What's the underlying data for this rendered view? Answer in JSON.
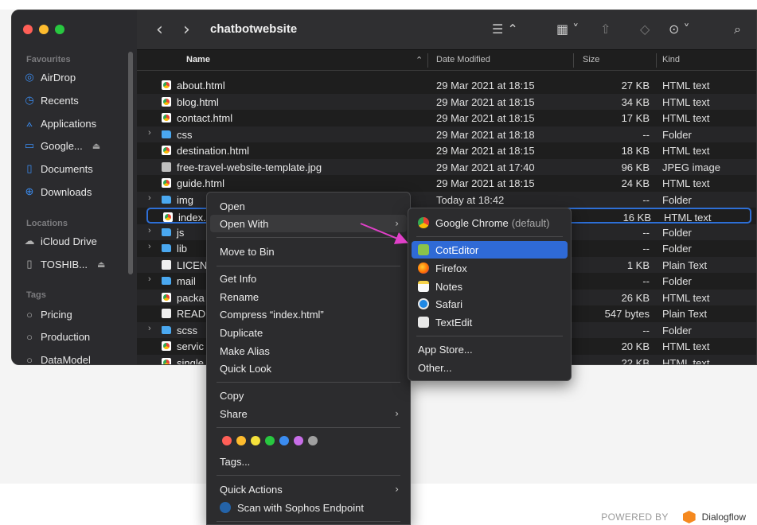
{
  "window": {
    "title": "chatbotwebsite",
    "traffic": [
      "close",
      "minimize",
      "maximize"
    ]
  },
  "toolbar": {
    "back_icon": "chevron-left-icon",
    "forward_icon": "chevron-right-icon",
    "view_icon": "list-view-icon",
    "group_icon": "group-icon",
    "share_icon": "share-icon",
    "tag_icon": "tag-icon",
    "more_icon": "ellipsis-circle-icon",
    "search_icon": "search-icon"
  },
  "sidebar": {
    "favourites_label": "Favourites",
    "locations_label": "Locations",
    "tags_label": "Tags",
    "favourites": [
      {
        "label": "AirDrop",
        "icon": "airdrop-icon"
      },
      {
        "label": "Recents",
        "icon": "clock-icon"
      },
      {
        "label": "Applications",
        "icon": "applications-icon"
      },
      {
        "label": "Google...",
        "icon": "drive-icon",
        "eject": true
      },
      {
        "label": "Documents",
        "icon": "document-icon"
      },
      {
        "label": "Downloads",
        "icon": "downloads-icon"
      }
    ],
    "locations": [
      {
        "label": "iCloud Drive",
        "icon": "cloud-icon"
      },
      {
        "label": "TOSHIB...",
        "icon": "disk-icon",
        "eject": true
      }
    ],
    "tags": [
      {
        "label": "Pricing"
      },
      {
        "label": "Production"
      },
      {
        "label": "DataModel"
      }
    ]
  },
  "columns": {
    "name": "Name",
    "date": "Date Modified",
    "size": "Size",
    "kind": "Kind"
  },
  "files": [
    {
      "name": "about.html",
      "date": "29 Mar 2021 at 18:15",
      "size": "27 KB",
      "kind": "HTML text",
      "type": "html"
    },
    {
      "name": "blog.html",
      "date": "29 Mar 2021 at 18:15",
      "size": "34 KB",
      "kind": "HTML text",
      "type": "html"
    },
    {
      "name": "contact.html",
      "date": "29 Mar 2021 at 18:15",
      "size": "17 KB",
      "kind": "HTML text",
      "type": "html"
    },
    {
      "name": "css",
      "date": "29 Mar 2021 at 18:18",
      "size": "--",
      "kind": "Folder",
      "type": "folder"
    },
    {
      "name": "destination.html",
      "date": "29 Mar 2021 at 18:15",
      "size": "18 KB",
      "kind": "HTML text",
      "type": "html"
    },
    {
      "name": "free-travel-website-template.jpg",
      "date": "29 Mar 2021 at 17:40",
      "size": "96 KB",
      "kind": "JPEG image",
      "type": "img"
    },
    {
      "name": "guide.html",
      "date": "29 Mar 2021 at 18:15",
      "size": "24 KB",
      "kind": "HTML text",
      "type": "html"
    },
    {
      "name": "img",
      "date": "Today at 18:42",
      "size": "--",
      "kind": "Folder",
      "type": "folder"
    },
    {
      "name": "index.h",
      "date": "",
      "size": "16 KB",
      "kind": "HTML text",
      "type": "html"
    },
    {
      "name": "js",
      "date": "",
      "size": "--",
      "kind": "Folder",
      "type": "folder"
    },
    {
      "name": "lib",
      "date": "",
      "size": "--",
      "kind": "Folder",
      "type": "folder"
    },
    {
      "name": "LICEN",
      "date": "",
      "size": "1 KB",
      "kind": "Plain Text",
      "type": "txt"
    },
    {
      "name": "mail",
      "date": "",
      "size": "--",
      "kind": "Folder",
      "type": "folder"
    },
    {
      "name": "packa",
      "date": "",
      "size": "26 KB",
      "kind": "HTML text",
      "type": "html"
    },
    {
      "name": "READ",
      "date": "",
      "size": "547 bytes",
      "kind": "Plain Text",
      "type": "txt"
    },
    {
      "name": "scss",
      "date": "",
      "size": "--",
      "kind": "Folder",
      "type": "folder"
    },
    {
      "name": "servic",
      "date": "",
      "size": "20 KB",
      "kind": "HTML text",
      "type": "html"
    },
    {
      "name": "single",
      "date": "",
      "size": "22 KB",
      "kind": "HTML text",
      "type": "html"
    }
  ],
  "context_menu": {
    "open": "Open",
    "open_with": "Open With",
    "move_to_bin": "Move to Bin",
    "get_info": "Get Info",
    "rename": "Rename",
    "compress": "Compress “index.html”",
    "duplicate": "Duplicate",
    "make_alias": "Make Alias",
    "quick_look": "Quick Look",
    "copy": "Copy",
    "share": "Share",
    "tags": "Tags...",
    "quick_actions": "Quick Actions",
    "scan": "Scan with Sophos Endpoint",
    "tag_colors": [
      "#ff5f57",
      "#febc2e",
      "#f5e13b",
      "#28c840",
      "#3b8cf0",
      "#c86ee8",
      "#a0a0a0"
    ]
  },
  "open_with_menu": {
    "chrome": "Google Chrome",
    "chrome_default": "(default)",
    "coteditor": "CotEditor",
    "firefox": "Firefox",
    "notes": "Notes",
    "safari": "Safari",
    "textedit": "TextEdit",
    "app_store": "App Store...",
    "other": "Other..."
  },
  "footer": {
    "powered_by": "POWERED BY",
    "brand": "Dialogflow"
  },
  "colors": {
    "selection": "#2f6ad6",
    "arrow": "#e040c8"
  }
}
